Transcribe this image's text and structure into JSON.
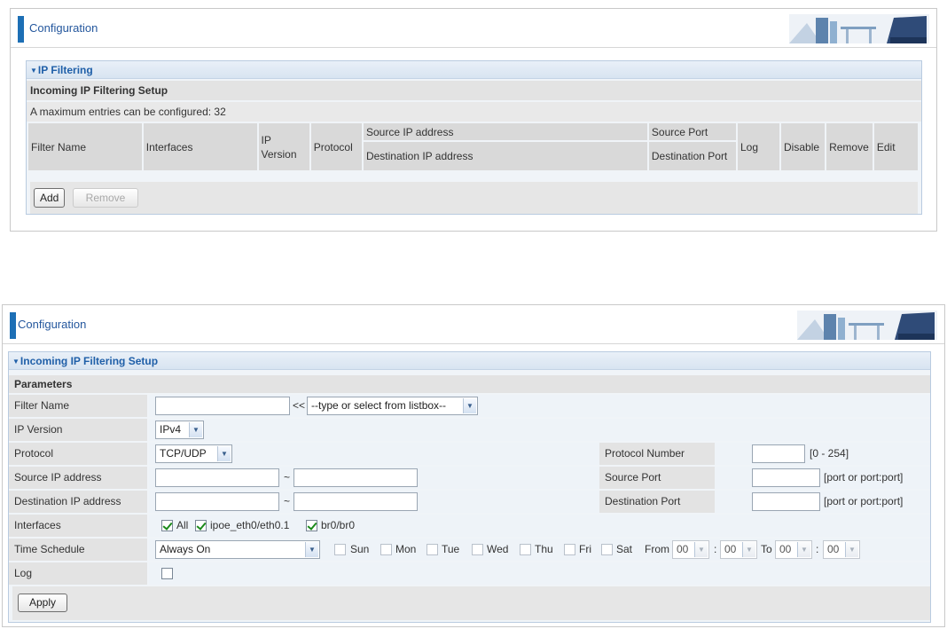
{
  "panel1": {
    "header_title": "Configuration",
    "section_title": "IP Filtering",
    "setup_title": "Incoming IP Filtering Setup",
    "max_entries": "A maximum entries can be configured: 32",
    "columns": {
      "filter_name": "Filter Name",
      "interfaces": "Interfaces",
      "ip_version": "IP Version",
      "protocol": "Protocol",
      "source_ip": "Source IP address",
      "destination_ip": "Destination IP address",
      "source_port": "Source Port",
      "destination_port": "Destination Port",
      "log": "Log",
      "disable": "Disable",
      "remove": "Remove",
      "edit": "Edit"
    },
    "add_button": "Add",
    "remove_button": "Remove"
  },
  "panel2": {
    "header_title": "Configuration",
    "section_title": "Incoming IP Filtering Setup",
    "parameters_title": "Parameters",
    "labels": {
      "filter_name": "Filter Name",
      "ip_version": "IP Version",
      "protocol": "Protocol",
      "source_ip": "Source IP address",
      "destination_ip": "Destination IP address",
      "interfaces": "Interfaces",
      "time_schedule": "Time Schedule",
      "log": "Log",
      "protocol_number": "Protocol Number",
      "source_port": "Source Port",
      "destination_port": "Destination Port"
    },
    "filter_name_value": "",
    "listbox_arrows": "<<",
    "listbox_select": "--type or select from listbox--",
    "ip_version_select": "IPv4",
    "protocol_select": "TCP/UDP",
    "protocol_number_hint": "[0 - 254]",
    "port_hint": "[port or port:port]",
    "range_sep": "~",
    "interfaces": [
      {
        "label": "All",
        "checked": true
      },
      {
        "label": "ipoe_eth0/eth0.1",
        "checked": true
      },
      {
        "label": "br0/br0",
        "checked": true
      }
    ],
    "time_schedule_select": "Always On",
    "days": [
      "Sun",
      "Mon",
      "Tue",
      "Wed",
      "Thu",
      "Fri",
      "Sat"
    ],
    "from_label": "From",
    "to_label": "To",
    "from_hour": "00",
    "from_minute": "00",
    "to_hour": "00",
    "to_minute": "00",
    "time_sep": ":",
    "log_checked": false,
    "apply_button": "Apply"
  },
  "colors": {
    "accent_bar": "#1d6fb5",
    "header_text": "#24579d",
    "section_header": "#1f5fa8",
    "check_mark": "#1a8a1a"
  },
  "icons": [
    "office-banner-image",
    "triangle-down-icon",
    "chevron-down-icon",
    "checkbox-icon"
  ]
}
